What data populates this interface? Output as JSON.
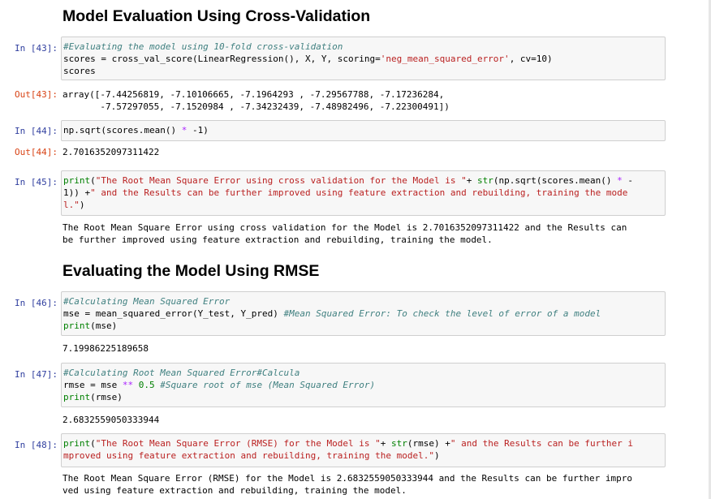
{
  "headings": {
    "cross_validation": "Model Evaluation Using Cross-Validation",
    "rmse": "Evaluating the Model Using RMSE"
  },
  "cells": {
    "c43": {
      "in_prompt": "In [43]:",
      "out_prompt": "Out[43]:",
      "code": [
        "#Evaluating the model using 10-fold cross-validation",
        "scores = cross_val_score(LinearRegression(), X, Y, scoring=",
        "'neg_mean_squared_error'",
        ", cv=10)",
        "scores"
      ],
      "output": [
        "array([-7.44256819, -7.10106665, -7.1964293 , -7.29567788, -7.17236284,",
        "       -7.57297055, -7.1520984 , -7.34232439, -7.48982496, -7.22300491])"
      ]
    },
    "c44": {
      "in_prompt": "In [44]:",
      "out_prompt": "Out[44]:",
      "code": [
        "np.sqrt(scores.mean() ",
        "*",
        " -1)"
      ],
      "output": [
        "2.7016352097311422"
      ]
    },
    "c45": {
      "in_prompt": "In [45]:",
      "code": [
        "print",
        "(",
        "\"The Root Mean Square Error using cross validation for the Model is \"",
        "+ ",
        "str",
        "(np.sqrt(scores.mean() ",
        "*",
        " -",
        "1)) +",
        "\" and the Results can be further improved using feature extraction and rebuilding, training the mode",
        "l.\"",
        ")"
      ],
      "output": [
        "The Root Mean Square Error using cross validation for the Model is 2.7016352097311422 and the Results can",
        "be further improved using feature extraction and rebuilding, training the model."
      ]
    },
    "c46": {
      "in_prompt": "In [46]:",
      "code": [
        "#Calculating Mean Squared Error",
        "mse = mean_squared_error(Y_test, Y_pred) ",
        "#Mean Squared Error: To check the level of error of a model",
        "print",
        "(mse)"
      ],
      "output": [
        "7.19986225189658"
      ]
    },
    "c47": {
      "in_prompt": "In [47]:",
      "code": [
        "#Calculating Root Mean Squared Error#Calcula",
        "rmse = mse ",
        "**",
        " 0.5 ",
        "#Square root of mse (Mean Squared Error)",
        "print",
        "(rmse)"
      ],
      "output": [
        "2.6832559050333944"
      ]
    },
    "c48": {
      "in_prompt": "In [48]:",
      "code": [
        "print",
        "(",
        "\"The Root Mean Square Error (RMSE) for the Model is \"",
        "+ ",
        "str",
        "(rmse) +",
        "\" and the Results can be further i",
        "mproved using feature extraction and rebuilding, training the model.\"",
        ")"
      ],
      "output": [
        "The Root Mean Square Error (RMSE) for the Model is 2.6832559050333944 and the Results can be further impro",
        "ved using feature extraction and rebuilding, training the model."
      ]
    }
  },
  "colors": {
    "in_prompt": "#303f9f",
    "out_prompt": "#d84315",
    "comment": "#408080",
    "string": "#ba2121",
    "keyword": "#008000",
    "operator": "#aa22ff",
    "cell_bg": "#f7f7f7",
    "cell_border": "#cfcfcf"
  }
}
